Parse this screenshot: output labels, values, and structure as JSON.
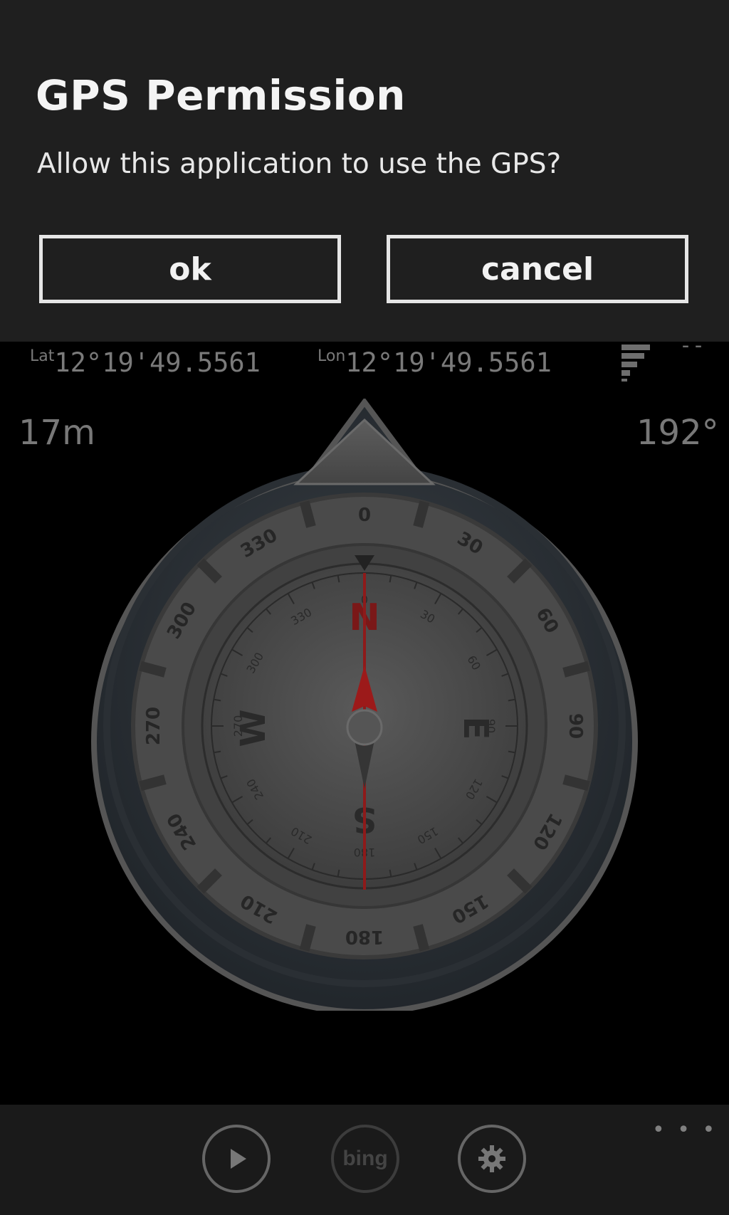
{
  "dialog": {
    "title": "GPS Permission",
    "message": "Allow this application to use the GPS?",
    "ok_label": "ok",
    "cancel_label": "cancel"
  },
  "status": {
    "lat_label": "Lat",
    "lat_value": "12°19'49.5561",
    "lon_label": "Lon",
    "lon_value": "12°19'49.5561",
    "gps_indicator": "--",
    "altitude": "17m",
    "heading": "192°"
  },
  "compass": {
    "outer_ring_labels": [
      "0",
      "30",
      "60",
      "90",
      "120",
      "150",
      "180",
      "210",
      "240",
      "270",
      "300",
      "330"
    ],
    "inner_ring_labels": [
      "0",
      "30",
      "60",
      "90",
      "120",
      "150",
      "180",
      "210",
      "240",
      "270",
      "300",
      "330"
    ],
    "cardinals": [
      "N",
      "E",
      "S",
      "W"
    ],
    "needle_color": "#a01818"
  },
  "appbar": {
    "play_icon": "play-icon",
    "bing_label": "bing",
    "settings_icon": "gear-icon",
    "more_label": "• • •"
  },
  "colors": {
    "dialog_bg": "#1f1f1f",
    "page_bg": "#000000",
    "appbar_bg": "#1a1a1a",
    "dim_text": "#787878"
  }
}
